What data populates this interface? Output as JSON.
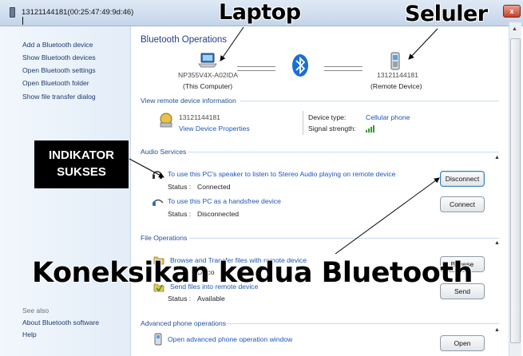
{
  "window": {
    "title": "13121144181(00:25:47:49:9d:46)",
    "close_label": "x"
  },
  "sidebar": {
    "tasks": [
      {
        "label": "Add a Bluetooth device"
      },
      {
        "label": "Show Bluetooth devices"
      },
      {
        "label": "Open Bluetooth settings"
      },
      {
        "label": "Open Bluetooth folder"
      },
      {
        "label": "Show file transfer dialog"
      }
    ],
    "see_also_title": "See also",
    "see_also": [
      {
        "label": "About Bluetooth software"
      },
      {
        "label": "Help"
      }
    ]
  },
  "operations": {
    "heading": "Bluetooth Operations",
    "computer": {
      "name": "NP355V4X-A02IDA",
      "role": "(This Computer)"
    },
    "remote": {
      "name": "13121144181",
      "role": "(Remote Device)"
    }
  },
  "remote_info": {
    "group_title": "View remote device information",
    "device_name": "13121144181",
    "view_properties": "View Device Properties",
    "device_type_label": "Device type:",
    "device_type_value": "Cellular phone",
    "signal_label": "Signal strength:"
  },
  "audio": {
    "group_title": "Audio Services",
    "services": [
      {
        "link": "To use this PC's speaker to listen to Stereo Audio playing on remote device",
        "status_label": "Status :",
        "status_value": "Connected",
        "button": "Disconnect"
      },
      {
        "link": "To use this PC as a handsfree device",
        "status_label": "Status :",
        "status_value": "Disconnected",
        "button": "Connect"
      }
    ]
  },
  "files": {
    "group_title": "File Operations",
    "items": [
      {
        "link": "Browse and Transfer files with remote device",
        "status_value": "Disco",
        "button": "Browse"
      },
      {
        "link": "Send files into remote device",
        "status_label": "Status :",
        "status_value": "Available",
        "button": "Send"
      }
    ]
  },
  "phone_ops": {
    "group_title": "Advanced phone operations",
    "link": "Open advanced phone operation window",
    "button": "Open"
  },
  "annotations": {
    "laptop": "Laptop",
    "cellular": "Seluler",
    "indicator": [
      "INDIKATOR",
      "SUKSES"
    ],
    "caption": "Koneksikan kedua Bluetooth"
  },
  "colors": {
    "link": "#1e56b8",
    "heading": "#1f3f8a",
    "bluetooth": "#1b6fd1"
  }
}
